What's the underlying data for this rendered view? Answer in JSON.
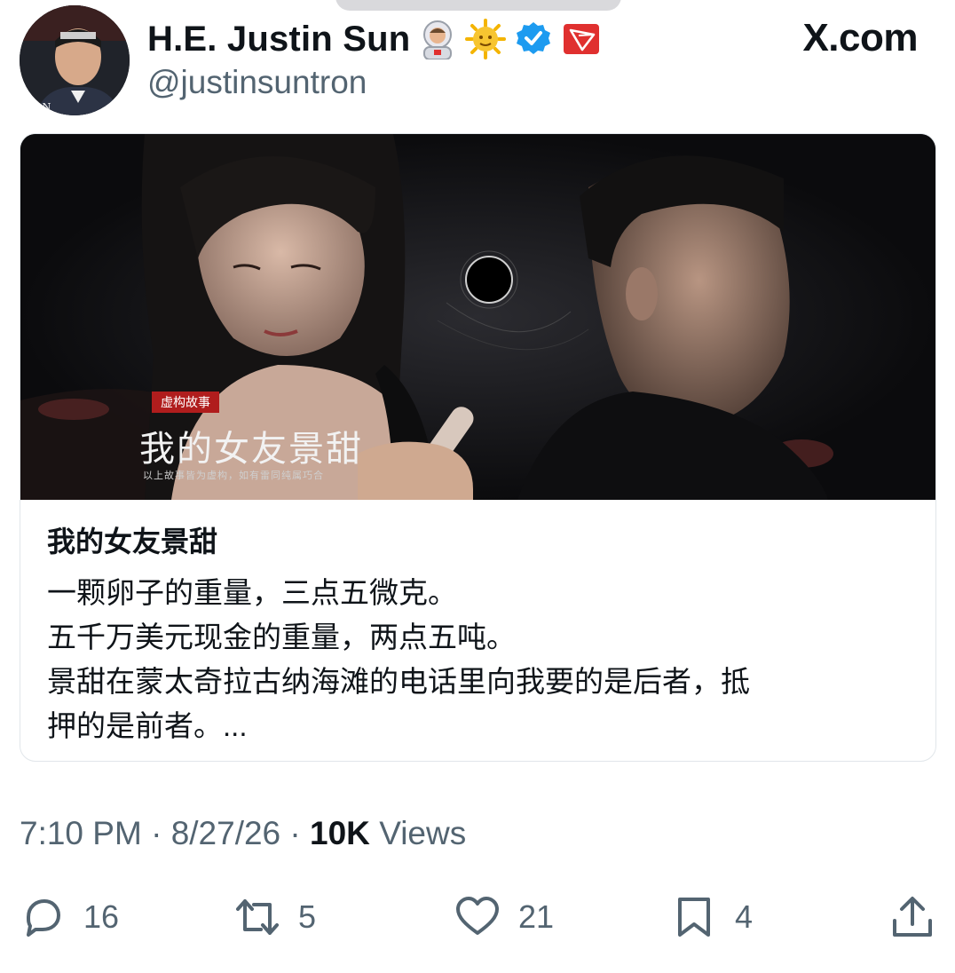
{
  "tweet": {
    "display_name": "H.E. Justin Sun",
    "handle": "@justinsuntron",
    "site": "X.com",
    "badges": [
      "astronaut-emoji",
      "sun-emoji",
      "verified-badge",
      "tron-logo"
    ],
    "avatar_text": "RION"
  },
  "card": {
    "poster_tag": "虚构故事",
    "poster_title": "我的女友景甜",
    "poster_note": "以上故事皆为虚构，如有雷同纯属巧合",
    "title": "我的女友景甜",
    "description_lines": [
      "一颗卵子的重量，三点五微克。",
      "五千万美元现金的重量，两点五吨。",
      "景甜在蒙太奇拉古纳海滩的电话里向我要的是后者，抵",
      "押的是前者。..."
    ]
  },
  "meta": {
    "time": "7:10 PM",
    "separator": "·",
    "date": "8/27/26",
    "views_count": "10K",
    "views_label": "Views"
  },
  "actions": {
    "reply_count": "16",
    "repost_count": "5",
    "like_count": "21",
    "bookmark_count": "4"
  },
  "colors": {
    "secondary_text": "#536471",
    "verified_blue": "#1d9bf0",
    "tron_red": "#e0302f"
  }
}
